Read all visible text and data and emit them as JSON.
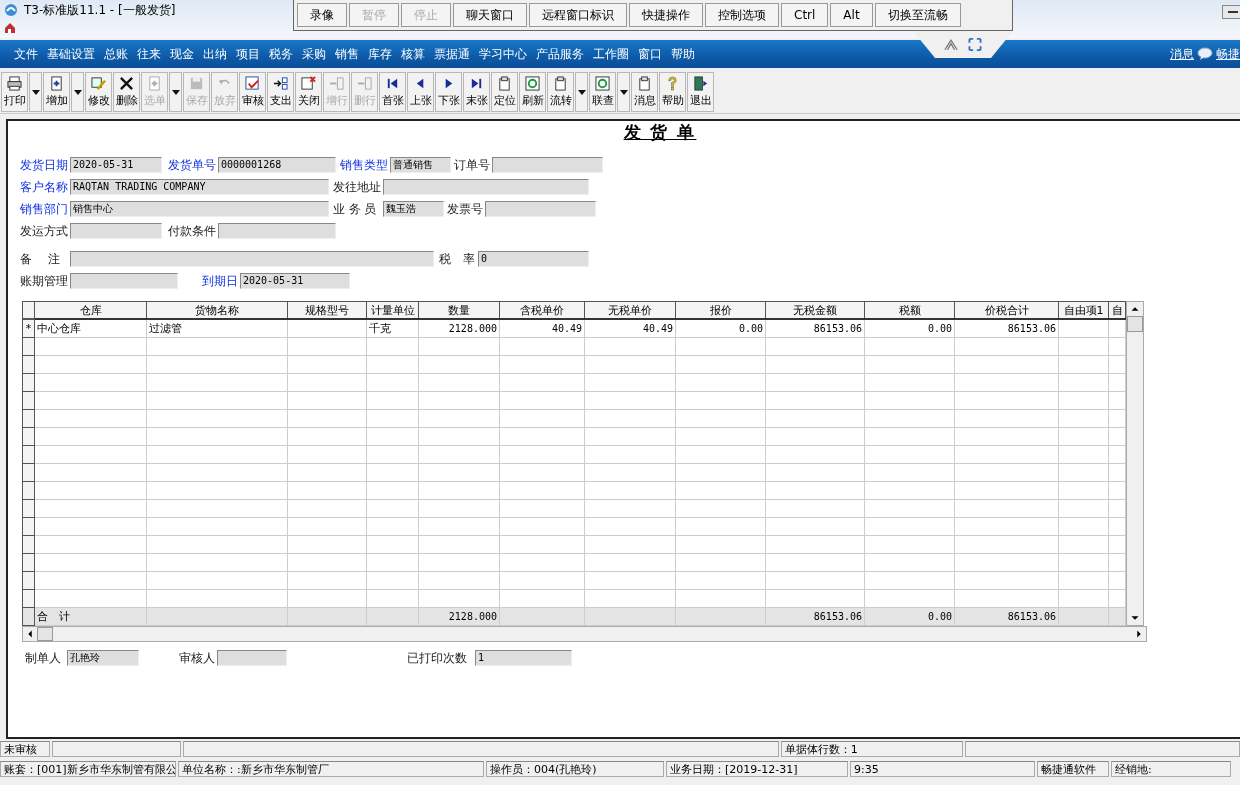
{
  "window": {
    "title": "T3-标准版11.1 - [一般发货]"
  },
  "remote_toolbar": [
    {
      "label": "录像",
      "disabled": false
    },
    {
      "label": "暂停",
      "disabled": true
    },
    {
      "label": "停止",
      "disabled": true
    },
    {
      "label": "聊天窗口",
      "disabled": false
    },
    {
      "label": "远程窗口标识",
      "disabled": false
    },
    {
      "label": "快捷操作",
      "disabled": false
    },
    {
      "label": "控制选项",
      "disabled": false
    },
    {
      "label": "Ctrl",
      "disabled": false
    },
    {
      "label": "Alt",
      "disabled": false
    },
    {
      "label": "切换至流畅",
      "disabled": false
    }
  ],
  "menu": [
    "文件",
    "基础设置",
    "总账",
    "往来",
    "现金",
    "出纳",
    "项目",
    "税务",
    "采购",
    "销售",
    "库存",
    "核算",
    "票据通",
    "学习中心",
    "产品服务",
    "工作圈",
    "窗口",
    "帮助"
  ],
  "menu_right": {
    "messages": "消息",
    "service": "畅捷"
  },
  "toolbar": [
    {
      "label": "打印",
      "kind": "printer",
      "disabled": false,
      "dropdown": true
    },
    {
      "label": "增加",
      "kind": "add",
      "disabled": false,
      "dropdown": true
    },
    {
      "label": "修改",
      "kind": "edit",
      "disabled": false,
      "dropdown": false
    },
    {
      "label": "删除",
      "kind": "delete",
      "disabled": false,
      "dropdown": false
    },
    {
      "label": "选单",
      "kind": "add",
      "disabled": true,
      "dropdown": true
    },
    {
      "label": "保存",
      "kind": "save",
      "disabled": true,
      "dropdown": false
    },
    {
      "label": "放弃",
      "kind": "undo",
      "disabled": true,
      "dropdown": false
    },
    {
      "label": "审核",
      "kind": "check",
      "disabled": false,
      "dropdown": false
    },
    {
      "label": "支出",
      "kind": "export",
      "disabled": false,
      "dropdown": false
    },
    {
      "label": "关闭",
      "kind": "close",
      "disabled": false,
      "dropdown": false
    },
    {
      "label": "增行",
      "kind": "row",
      "disabled": true,
      "dropdown": false
    },
    {
      "label": "删行",
      "kind": "row",
      "disabled": true,
      "dropdown": false
    },
    {
      "label": "首张",
      "kind": "first",
      "disabled": false,
      "dropdown": false
    },
    {
      "label": "上张",
      "kind": "prev",
      "disabled": false,
      "dropdown": false
    },
    {
      "label": "下张",
      "kind": "next",
      "disabled": false,
      "dropdown": false
    },
    {
      "label": "末张",
      "kind": "last",
      "disabled": false,
      "dropdown": false
    },
    {
      "label": "定位",
      "kind": "doc",
      "disabled": false,
      "dropdown": false
    },
    {
      "label": "刷新",
      "kind": "refresh",
      "disabled": false,
      "dropdown": false
    },
    {
      "label": "流转",
      "kind": "doc",
      "disabled": false,
      "dropdown": true
    },
    {
      "label": "联查",
      "kind": "refresh",
      "disabled": false,
      "dropdown": true
    },
    {
      "label": "消息",
      "kind": "doc",
      "disabled": false,
      "dropdown": false
    },
    {
      "label": "帮助",
      "kind": "help",
      "disabled": false,
      "dropdown": false
    },
    {
      "label": "退出",
      "kind": "exit",
      "disabled": false,
      "dropdown": false
    }
  ],
  "form": {
    "title": "发 货 单",
    "fields": [
      {
        "label": "发货日期",
        "value": "2020-05-31",
        "required": true
      },
      {
        "label": "发货单号",
        "value": "0000001268",
        "required": true
      },
      {
        "label": "销售类型",
        "value": "普通销售",
        "required": true
      },
      {
        "label": "订单号",
        "required": false
      },
      {
        "label": "客户名称",
        "value": "RAQTAN TRADING COMPANY",
        "required": true
      },
      {
        "label": "发往地址",
        "required": false
      },
      {
        "label": "销售部门",
        "value": "销售中心",
        "required": true
      },
      {
        "label": "业 务 员",
        "value": "魏玉浩",
        "required": false
      },
      {
        "label": "发票号",
        "required": false
      },
      {
        "label": "发运方式",
        "required": false
      },
      {
        "label": "付款条件",
        "required": false
      },
      {
        "label": "备　 注",
        "required": false
      },
      {
        "label": "税　率",
        "value": "0",
        "required": false
      },
      {
        "label": "账期管理",
        "required": false
      },
      {
        "label": "到期日",
        "value": "2020-05-31",
        "required": true
      }
    ],
    "footer": [
      {
        "label": "制单人",
        "value": "孔艳玲"
      },
      {
        "label": "审核人"
      },
      {
        "label": "已打印次数",
        "value": "1"
      }
    ]
  },
  "table": {
    "columns": [
      "仓库",
      "货物名称",
      "规格型号",
      "计量单位",
      "数量",
      "含税单价",
      "无税单价",
      "报价",
      "无税金额",
      "税额",
      "价税合计",
      "自由项1",
      "自"
    ],
    "rows": [
      {
        "marker": "*",
        "cells": [
          "中心仓库",
          "过滤管",
          null,
          "千克",
          "2128.000",
          "40.49",
          "40.49",
          "0.00",
          "86153.06",
          "0.00",
          "86153.06",
          null,
          null
        ]
      }
    ],
    "total": {
      "label": "合　计",
      "cells": [
        null,
        null,
        null,
        null,
        "2128.000",
        null,
        null,
        null,
        "86153.06",
        "0.00",
        "86153.06",
        null,
        null
      ]
    }
  },
  "status_bar": {
    "state": "未审核",
    "row_count": "单据体行数：1",
    "line_2": [
      "账套：[001]新乡市华东制管有限公",
      "单位名称：:新乡市华东制管厂",
      "操作员：004(孔艳玲)",
      "业务日期：[2019-12-31]",
      "9:35",
      "畅捷通软件",
      "经销地:"
    ]
  }
}
